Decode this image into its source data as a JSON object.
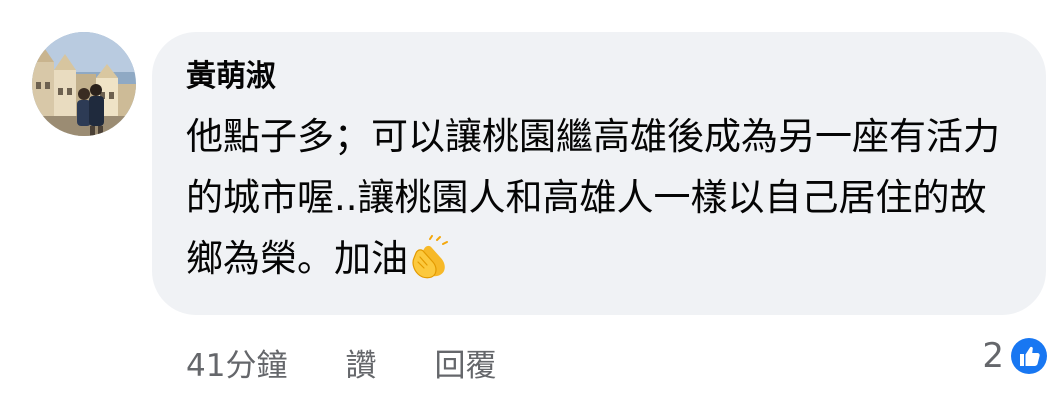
{
  "comment": {
    "author": "黃萌淑",
    "text": "他點子多；可以讓桃園繼高雄後成為另一座有活力的城市喔..讓桃園人和高雄人一樣以自己居住的故鄉為榮。加油",
    "emoji": "clapping-hands"
  },
  "actions": {
    "time": "41分鐘",
    "like": "讚",
    "reply": "回覆"
  },
  "reactions": {
    "count": "2",
    "type": "like-icon"
  },
  "colors": {
    "bubble": "#f0f2f5",
    "text": "#050505",
    "secondary": "#65676b",
    "like_blue": "#1877f2"
  }
}
